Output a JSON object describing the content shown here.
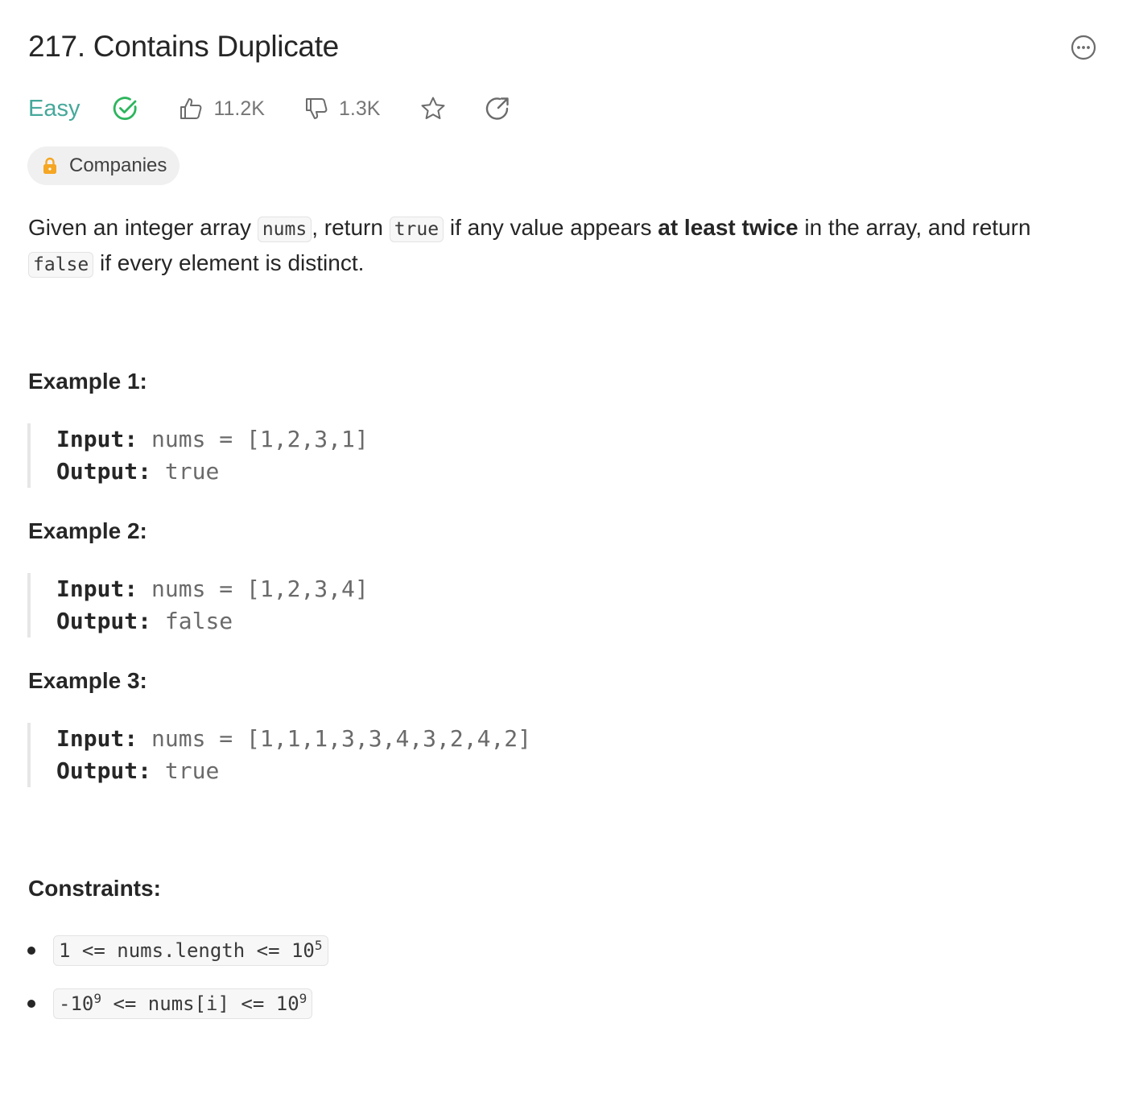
{
  "problem": {
    "title": "217. Contains Duplicate",
    "difficulty": "Easy",
    "likes": "11.2K",
    "dislikes": "1.3K",
    "companies_label": "Companies"
  },
  "description": {
    "p1": "Given an integer array ",
    "code1": "nums",
    "p2": ", return ",
    "code2": "true",
    "p3": " if any value appears ",
    "bold": "at least twice",
    "p4": " in the array, and return ",
    "code3": "false",
    "p5": " if every element is distinct."
  },
  "examples": [
    {
      "title": "Example 1:",
      "input_label": "Input:",
      "input": "nums = [1,2,3,1]",
      "output_label": "Output:",
      "output": "true"
    },
    {
      "title": "Example 2:",
      "input_label": "Input:",
      "input": "nums = [1,2,3,4]",
      "output_label": "Output:",
      "output": "false"
    },
    {
      "title": "Example 3:",
      "input_label": "Input:",
      "input": "nums = [1,1,1,3,3,4,3,2,4,2]",
      "output_label": "Output:",
      "output": "true"
    }
  ],
  "constraints": {
    "title": "Constraints:",
    "c1_text": "1 <= nums.length <= 10",
    "c1_exp": "5",
    "c2_pre": "-10",
    "c2_exp1": "9",
    "c2_mid": " <= nums[i] <= 10",
    "c2_exp2": "9"
  },
  "colors": {
    "easy": "#46a89a",
    "solved": "#2db55d",
    "lock": "#f5a623"
  },
  "icons": [
    "more-icon",
    "solved-check-icon",
    "thumbs-up-icon",
    "thumbs-down-icon",
    "star-icon",
    "share-icon",
    "lock-icon"
  ]
}
